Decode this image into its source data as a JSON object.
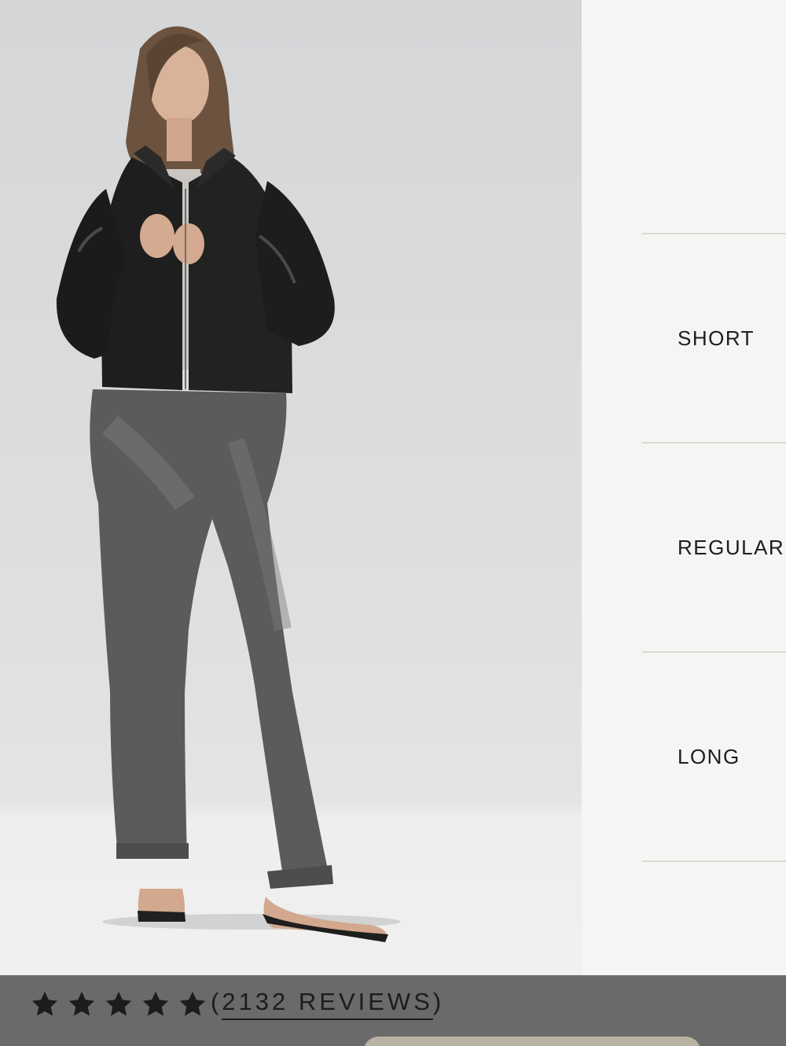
{
  "product_image": {
    "alt": "",
    "background": "#d8dadb"
  },
  "length_options": [
    {
      "label": "SHORT"
    },
    {
      "label": "REGULAR"
    },
    {
      "label": "LONG"
    }
  ],
  "reviews": {
    "rating": 5,
    "max_rating": 5,
    "open_paren": "(",
    "count_text": "2132 REVIEWS",
    "close_paren": ")",
    "star_icon": "star-icon",
    "star_color": "#1c1c1c"
  },
  "colors": {
    "panel_background": "#f5f5f3",
    "divider": "#d9d9d6",
    "review_bar": "#6a6a6a",
    "text": "#1d1d1d"
  }
}
